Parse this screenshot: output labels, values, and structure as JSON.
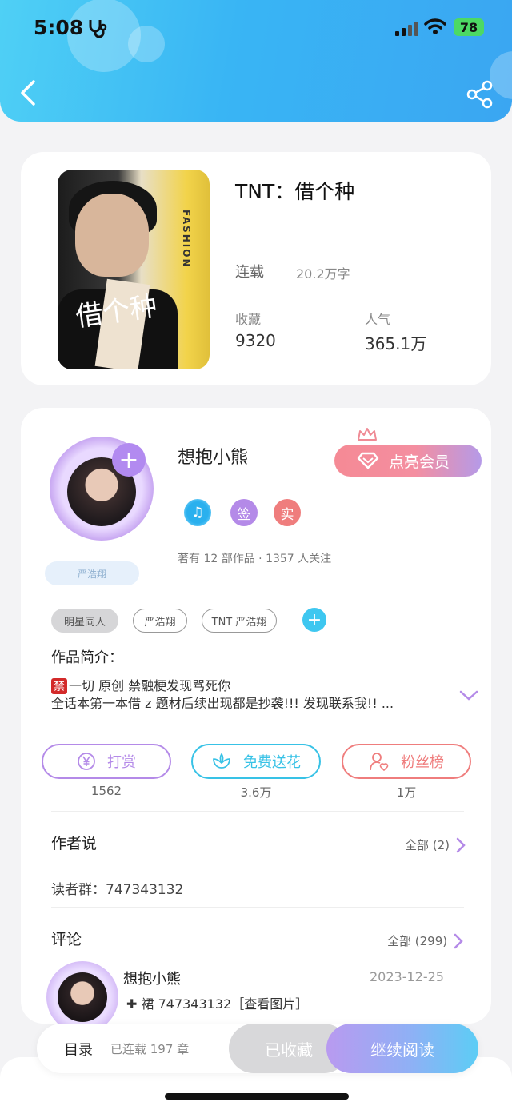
{
  "status_bar": {
    "time": "5:08",
    "battery": "78"
  },
  "book": {
    "title": "TNT：借个种",
    "status": "连载",
    "word_count": "20.2万字",
    "favorites_label": "收藏",
    "favorites_value": "9320",
    "popularity_label": "人气",
    "popularity_value": "365.1万",
    "cover_vertical_text": "FASHION",
    "cover_calligraphy": "借个种"
  },
  "author": {
    "name": "想抱小熊",
    "vip_label": "点亮会员",
    "name_tag": "严浩翔",
    "badges": [
      "签",
      "实"
    ],
    "meta": "著有 12 部作品 · 1357 人关注",
    "tags": [
      "明星同人",
      "严浩翔",
      "TNT 严浩翔"
    ],
    "intro_label": "作品简介：",
    "intro_ban": "禁",
    "intro_line1": "一切 原创 禁融梗发现骂死你",
    "intro_line2": "全话本第一本借 z 题材后续出现都是抄袭!!! 发现联系我!! ..."
  },
  "actions": [
    {
      "label": "打赏",
      "count": "1562",
      "icon": "yen-coin-icon",
      "color": "#b48ae8"
    },
    {
      "label": "免费送花",
      "count": "3.6万",
      "icon": "flower-icon",
      "color": "#38c2e6"
    },
    {
      "label": "粉丝榜",
      "count": "1万",
      "icon": "user-heart-icon",
      "color": "#ef7d7d"
    }
  ],
  "author_says": {
    "title": "作者说",
    "more": "全部 (2)",
    "content": "读者群：747343132"
  },
  "comments": {
    "title": "评论",
    "more": "全部 (299)",
    "items": [
      {
        "name": "想抱小熊",
        "date": "2023-12-25",
        "text": "✚ 裙 747343132［查看图片］"
      }
    ]
  },
  "bottom_bar": {
    "toc": "目录",
    "chapters": "已连载 197 章",
    "collected": "已收藏",
    "continue": "继续阅读"
  }
}
